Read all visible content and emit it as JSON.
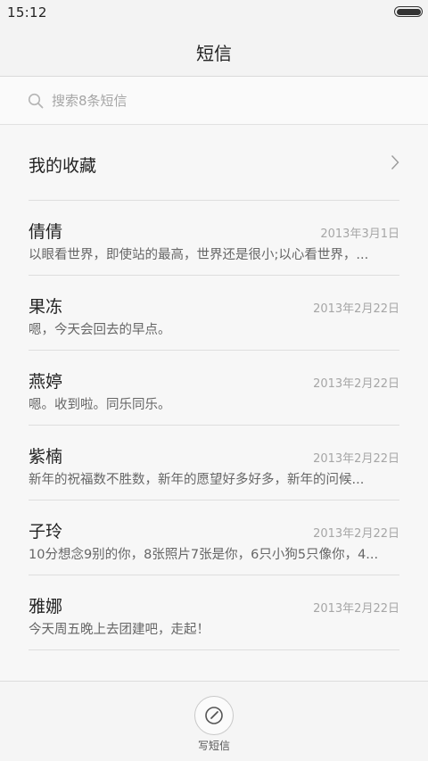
{
  "status_bar": {
    "time": "15:12"
  },
  "header": {
    "title": "短信"
  },
  "search": {
    "placeholder": "搜索8条短信"
  },
  "favorites": {
    "label": "我的收藏"
  },
  "messages": [
    {
      "name": "倩倩",
      "date": "2013年3月1日",
      "preview": "以眼看世界，即使站的最高，世界还是很小;以心看世界，..."
    },
    {
      "name": "果冻",
      "date": "2013年2月22日",
      "preview": "嗯，今天会回去的早点。"
    },
    {
      "name": "燕婷",
      "date": "2013年2月22日",
      "preview": "嗯。收到啦。同乐同乐。"
    },
    {
      "name": "紫楠",
      "date": "2013年2月22日",
      "preview": "新年的祝福数不胜数，新年的愿望好多好多，新年的问候..."
    },
    {
      "name": "子玲",
      "date": "2013年2月22日",
      "preview": "10分想念9别的你，8张照片7张是你，6只小狗5只像你，4..."
    },
    {
      "name": "雅娜",
      "date": "2013年2月22日",
      "preview": "今天周五晚上去团建吧，走起！"
    }
  ],
  "bottom": {
    "compose_label": "写短信"
  },
  "icons": {
    "search": "search-icon",
    "chevron": "chevron-right-icon",
    "compose": "compose-icon",
    "battery": "battery-icon"
  },
  "colors": {
    "background": "#f7f7f7",
    "header": "#f3f3f3",
    "divider": "#dedede",
    "secondary_text": "#a6a6a6"
  }
}
